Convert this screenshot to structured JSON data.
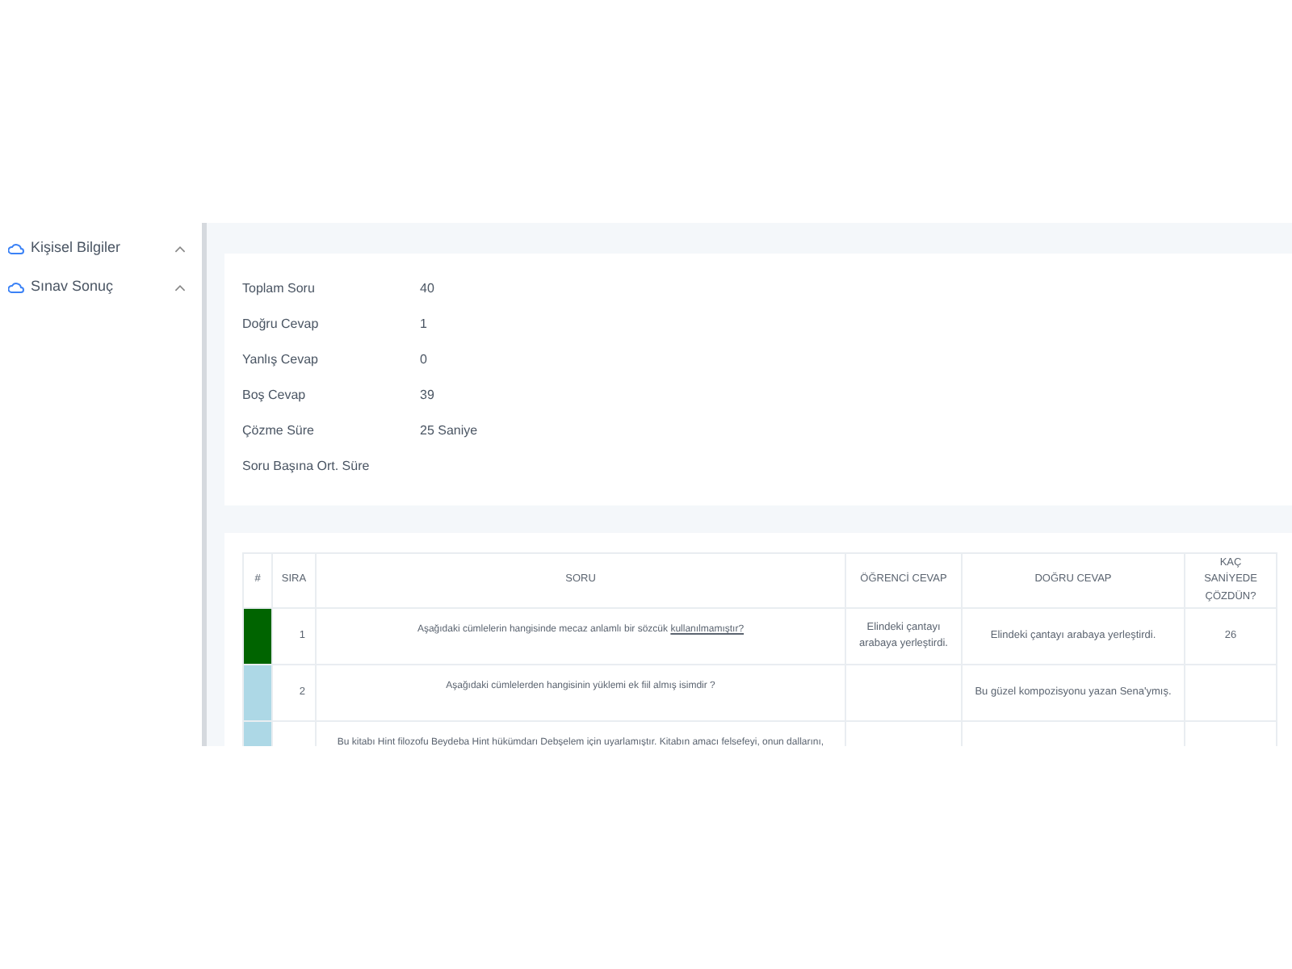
{
  "sidebar": {
    "items": [
      {
        "label": "Kişisel Bilgiler",
        "expanded": true
      },
      {
        "label": "Sınav Sonuç",
        "expanded": true
      }
    ]
  },
  "summary": [
    {
      "label": "Toplam Soru",
      "value": "40"
    },
    {
      "label": "Doğru Cevap",
      "value": "1"
    },
    {
      "label": "Yanlış Cevap",
      "value": "0"
    },
    {
      "label": "Boş Cevap",
      "value": "39"
    },
    {
      "label": "Çözme Süre",
      "value": "25 Saniye"
    },
    {
      "label": "Soru Başına Ort. Süre"
    }
  ],
  "table": {
    "columns": [
      "#",
      "SIRA",
      "SORU",
      "ÖĞRENCİ CEVAP",
      "DOĞRU CEVAP",
      "KAÇ SANİYEDE ÇÖZDÜN?"
    ],
    "rows": [
      {
        "color": "#006400",
        "order": "1",
        "question": "Aşağıdaki cümlelerin hangisinde mecaz anlamlı bir sözcük",
        "question_underlined": "kullanılmamıştır?",
        "student_answer": "Elindeki çantayı arabaya yerleştirdi.",
        "correct_answer": "Elindeki çantayı arabaya yerleştirdi.",
        "seconds": "26"
      },
      {
        "color": "#add8e6",
        "order": "2",
        "question": "Aşağıdaki cümlelerden hangisinin yüklemi ek fiil almış isimdir ?",
        "correct_answer": "Bu güzel kompozisyonu yazan Sena'ymış."
      },
      {
        "color": "#add8e6",
        "question": "Bu kitabı Hint filozofu Beydeba Hint hükümdarı Debşelem için uyarlamıştır. Kitabın amacı felsefeyi, onun dallarını,"
      }
    ]
  }
}
